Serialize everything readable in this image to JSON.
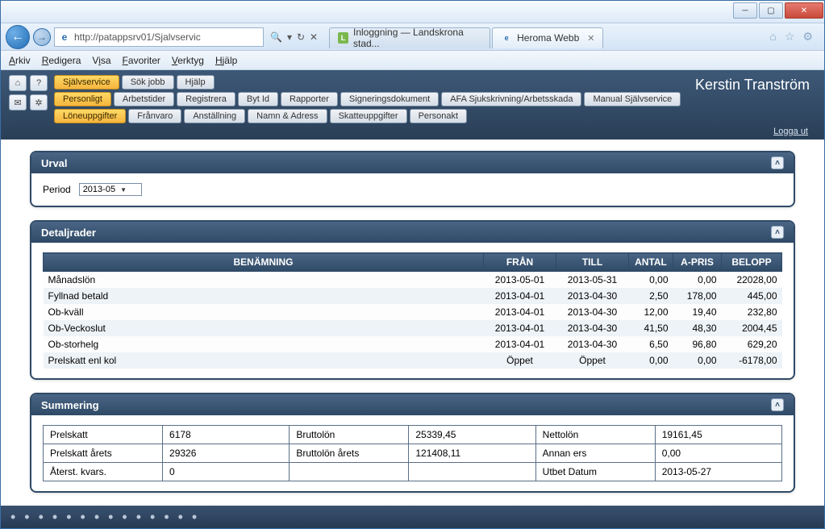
{
  "window": {
    "url": "http://patappsrv01/Sjalvservic",
    "tabs": [
      {
        "label": "Inloggning — Landskrona stad...",
        "active": false
      },
      {
        "label": "Heroma Webb",
        "active": true
      }
    ]
  },
  "menubar": [
    "Arkiv",
    "Redigera",
    "Visa",
    "Favoriter",
    "Verktyg",
    "Hjälp"
  ],
  "app": {
    "user": "Kerstin Tranström",
    "logout": "Logga ut",
    "row1": [
      "Självservice",
      "Sök jobb",
      "Hjälp"
    ],
    "row1_active": "Självservice",
    "row2": [
      "Personligt",
      "Arbetstider",
      "Registrera",
      "Byt Id",
      "Rapporter",
      "Signeringsdokument",
      "AFA Sjukskrivning/Arbetsskada",
      "Manual Självservice"
    ],
    "row2_active": "Personligt",
    "row3": [
      "Löneuppgifter",
      "Frånvaro",
      "Anställning",
      "Namn & Adress",
      "Skatteuppgifter",
      "Personakt"
    ],
    "row3_active": "Löneuppgifter"
  },
  "urval": {
    "title": "Urval",
    "period_label": "Period",
    "period_value": "2013-05"
  },
  "detaljrader": {
    "title": "Detaljrader",
    "headers": [
      "BENÄMNING",
      "FRÅN",
      "TILL",
      "ANTAL",
      "A-PRIS",
      "BELOPP"
    ],
    "rows": [
      {
        "ben": "Månadslön",
        "fran": "2013-05-01",
        "till": "2013-05-31",
        "antal": "0,00",
        "apris": "0,00",
        "belopp": "22028,00"
      },
      {
        "ben": "Fyllnad betald",
        "fran": "2013-04-01",
        "till": "2013-04-30",
        "antal": "2,50",
        "apris": "178,00",
        "belopp": "445,00"
      },
      {
        "ben": "Ob-kväll",
        "fran": "2013-04-01",
        "till": "2013-04-30",
        "antal": "12,00",
        "apris": "19,40",
        "belopp": "232,80"
      },
      {
        "ben": "Ob-Veckoslut",
        "fran": "2013-04-01",
        "till": "2013-04-30",
        "antal": "41,50",
        "apris": "48,30",
        "belopp": "2004,45"
      },
      {
        "ben": "Ob-storhelg",
        "fran": "2013-04-01",
        "till": "2013-04-30",
        "antal": "6,50",
        "apris": "96,80",
        "belopp": "629,20"
      },
      {
        "ben": "Prelskatt enl kol",
        "fran": "Öppet",
        "till": "Öppet",
        "antal": "0,00",
        "apris": "0,00",
        "belopp": "-6178,00"
      }
    ]
  },
  "summering": {
    "title": "Summering",
    "rows": [
      [
        {
          "l": "Prelskatt",
          "v": "6178"
        },
        {
          "l": "Bruttolön",
          "v": "25339,45"
        },
        {
          "l": "Nettolön",
          "v": "19161,45"
        }
      ],
      [
        {
          "l": "Prelskatt årets",
          "v": "29326"
        },
        {
          "l": "Bruttolön årets",
          "v": "121408,11"
        },
        {
          "l": "Annan ers",
          "v": "0,00"
        }
      ],
      [
        {
          "l": "Återst. kvars.",
          "v": "0"
        },
        {
          "l": "",
          "v": ""
        },
        {
          "l": "Utbet Datum",
          "v": "2013-05-27"
        }
      ]
    ]
  }
}
